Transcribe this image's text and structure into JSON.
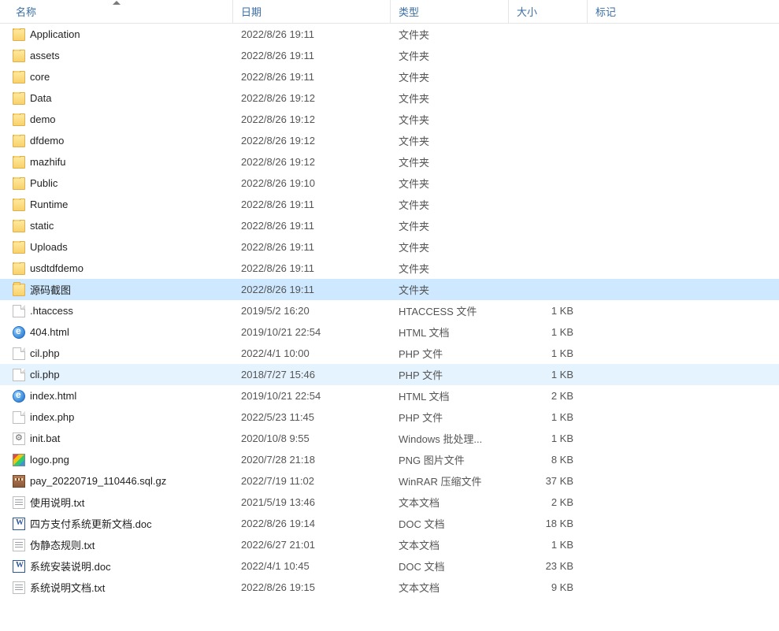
{
  "columns": {
    "name": "名称",
    "date": "日期",
    "type": "类型",
    "size": "大小",
    "tag": "标记"
  },
  "sorted_by": "name",
  "sort_dir": "asc",
  "rows": [
    {
      "icon": "folder",
      "name": "Application",
      "date": "2022/8/26 19:11",
      "type": "文件夹",
      "size": "",
      "state": ""
    },
    {
      "icon": "folder",
      "name": "assets",
      "date": "2022/8/26 19:11",
      "type": "文件夹",
      "size": "",
      "state": ""
    },
    {
      "icon": "folder",
      "name": "core",
      "date": "2022/8/26 19:11",
      "type": "文件夹",
      "size": "",
      "state": ""
    },
    {
      "icon": "folder",
      "name": "Data",
      "date": "2022/8/26 19:12",
      "type": "文件夹",
      "size": "",
      "state": ""
    },
    {
      "icon": "folder",
      "name": "demo",
      "date": "2022/8/26 19:12",
      "type": "文件夹",
      "size": "",
      "state": ""
    },
    {
      "icon": "folder",
      "name": "dfdemo",
      "date": "2022/8/26 19:12",
      "type": "文件夹",
      "size": "",
      "state": ""
    },
    {
      "icon": "folder",
      "name": "mazhifu",
      "date": "2022/8/26 19:12",
      "type": "文件夹",
      "size": "",
      "state": ""
    },
    {
      "icon": "folder",
      "name": "Public",
      "date": "2022/8/26 19:10",
      "type": "文件夹",
      "size": "",
      "state": ""
    },
    {
      "icon": "folder",
      "name": "Runtime",
      "date": "2022/8/26 19:11",
      "type": "文件夹",
      "size": "",
      "state": ""
    },
    {
      "icon": "folder",
      "name": "static",
      "date": "2022/8/26 19:11",
      "type": "文件夹",
      "size": "",
      "state": ""
    },
    {
      "icon": "folder",
      "name": "Uploads",
      "date": "2022/8/26 19:11",
      "type": "文件夹",
      "size": "",
      "state": ""
    },
    {
      "icon": "folder",
      "name": "usdtdfdemo",
      "date": "2022/8/26 19:11",
      "type": "文件夹",
      "size": "",
      "state": ""
    },
    {
      "icon": "folder",
      "name": "源码截图",
      "date": "2022/8/26 19:11",
      "type": "文件夹",
      "size": "",
      "state": "selected"
    },
    {
      "icon": "file",
      "name": ".htaccess",
      "date": "2019/5/2 16:20",
      "type": "HTACCESS 文件",
      "size": "1 KB",
      "state": ""
    },
    {
      "icon": "html",
      "name": "404.html",
      "date": "2019/10/21 22:54",
      "type": "HTML 文档",
      "size": "1 KB",
      "state": ""
    },
    {
      "icon": "file",
      "name": "cil.php",
      "date": "2022/4/1 10:00",
      "type": "PHP 文件",
      "size": "1 KB",
      "state": ""
    },
    {
      "icon": "file",
      "name": "cli.php",
      "date": "2018/7/27 15:46",
      "type": "PHP 文件",
      "size": "1 KB",
      "state": "hover"
    },
    {
      "icon": "html",
      "name": "index.html",
      "date": "2019/10/21 22:54",
      "type": "HTML 文档",
      "size": "2 KB",
      "state": ""
    },
    {
      "icon": "file",
      "name": "index.php",
      "date": "2022/5/23 11:45",
      "type": "PHP 文件",
      "size": "1 KB",
      "state": ""
    },
    {
      "icon": "bat",
      "name": "init.bat",
      "date": "2020/10/8 9:55",
      "type": "Windows 批处理...",
      "size": "1 KB",
      "state": ""
    },
    {
      "icon": "png",
      "name": "logo.png",
      "date": "2020/7/28 21:18",
      "type": "PNG 图片文件",
      "size": "8 KB",
      "state": ""
    },
    {
      "icon": "gz",
      "name": "pay_20220719_110446.sql.gz",
      "date": "2022/7/19 11:02",
      "type": "WinRAR 压缩文件",
      "size": "37 KB",
      "state": ""
    },
    {
      "icon": "txt",
      "name": "使用说明.txt",
      "date": "2021/5/19 13:46",
      "type": "文本文档",
      "size": "2 KB",
      "state": ""
    },
    {
      "icon": "doc",
      "name": "四方支付系统更新文档.doc",
      "date": "2022/8/26 19:14",
      "type": "DOC 文档",
      "size": "18 KB",
      "state": ""
    },
    {
      "icon": "txt",
      "name": "伪静态规则.txt",
      "date": "2022/6/27 21:01",
      "type": "文本文档",
      "size": "1 KB",
      "state": ""
    },
    {
      "icon": "doc",
      "name": "系统安装说明.doc",
      "date": "2022/4/1 10:45",
      "type": "DOC 文档",
      "size": "23 KB",
      "state": ""
    },
    {
      "icon": "txt",
      "name": "系统说明文档.txt",
      "date": "2022/8/26 19:15",
      "type": "文本文档",
      "size": "9 KB",
      "state": ""
    }
  ]
}
